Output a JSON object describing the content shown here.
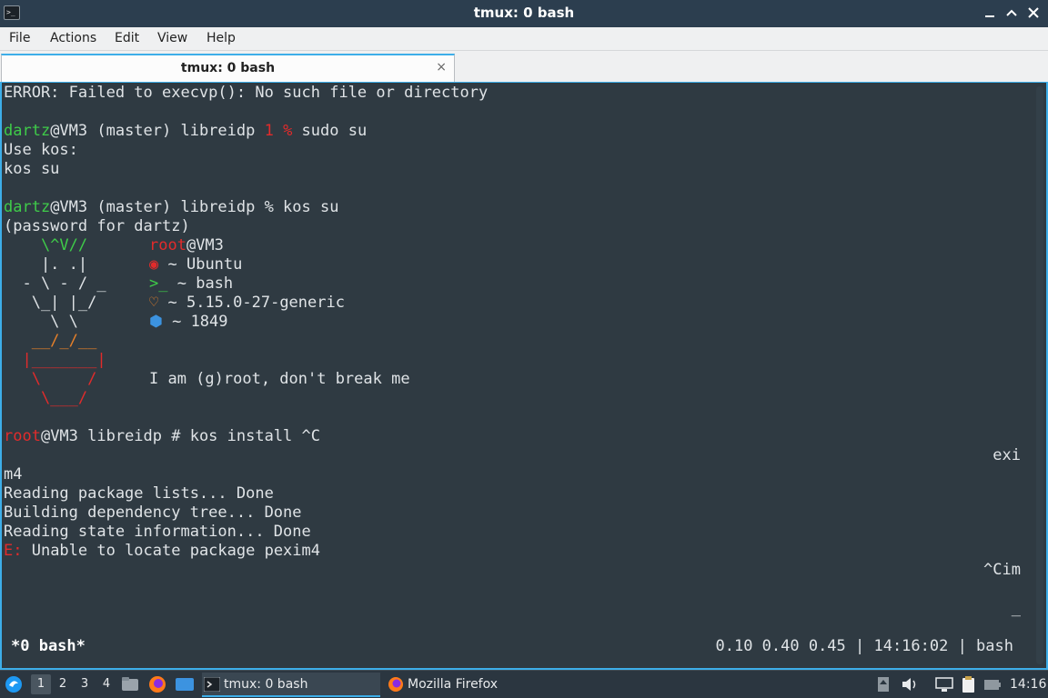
{
  "window": {
    "title": "tmux: 0 bash",
    "app_icon_text": ">_"
  },
  "menu": [
    "File",
    "Actions",
    "Edit",
    "View",
    "Help"
  ],
  "tab": {
    "label": "tmux: 0 bash",
    "close_glyph": "×"
  },
  "terminal": {
    "error_line": "ERROR: Failed to execvp(): No such file or directory",
    "p1_user": "dartz",
    "p1_rest": "@VM3 (master) libreidp ",
    "p1_code": "1 %",
    "p1_cmd": " sudo su",
    "use_kos": "Use kos:",
    "kos_su": "kos su",
    "p2_user": "dartz",
    "p2_rest": "@VM3 (master) libreidp % kos su",
    "password_line": "(password for dartz)",
    "art": {
      "a1": "    \\^V//",
      "a2": "    |. .|",
      "a3": "  - \\ - / _",
      "a4": "   \\_| |_/",
      "a5": "     \\ \\",
      "a6": "   __/_/__",
      "a7": "  |_______|",
      "a8": "   \\     /",
      "a9": "    \\___/"
    },
    "info": {
      "user": "root",
      "host": "@VM3",
      "os_icon": "◉",
      "os": "~ Ubuntu",
      "shell_icon": ">_",
      "shell": "~ bash",
      "kernel_icon": "♡",
      "kernel": "~ 5.15.0-27-generic",
      "pkg_icon": "⬢",
      "packages": "~ 1849",
      "motto": "I am (g)root, don't break me"
    },
    "p3_user": "root",
    "p3_rest": "@VM3 libreidp # kos install ^C",
    "wrap_exi": "exi",
    "m4": "m4",
    "apt1": "Reading package lists... Done",
    "apt2": "Building dependency tree... Done",
    "apt3": "Reading state information... Done",
    "err_prefix": "E:",
    "err_msg": " Unable to locate package pexim4",
    "wrap_cim": "^Cim",
    "cursor": "_"
  },
  "tmux_status": {
    "window": "*0 bash*",
    "right": "0.10 0.40 0.45 | 14:16:02 | bash"
  },
  "taskbar": {
    "desktops": [
      "1",
      "2",
      "3",
      "4"
    ],
    "tasks": [
      {
        "label": "tmux: 0 bash",
        "icon": "terminal-icon"
      },
      {
        "label": "Mozilla Firefox",
        "icon": "firefox-icon"
      }
    ],
    "clock": "14:16"
  },
  "colors": {
    "accent": "#3daee9",
    "prompt_green": "#3fcb49",
    "prompt_red": "#e22b2b",
    "terminal_bg": "#2f3a42"
  }
}
